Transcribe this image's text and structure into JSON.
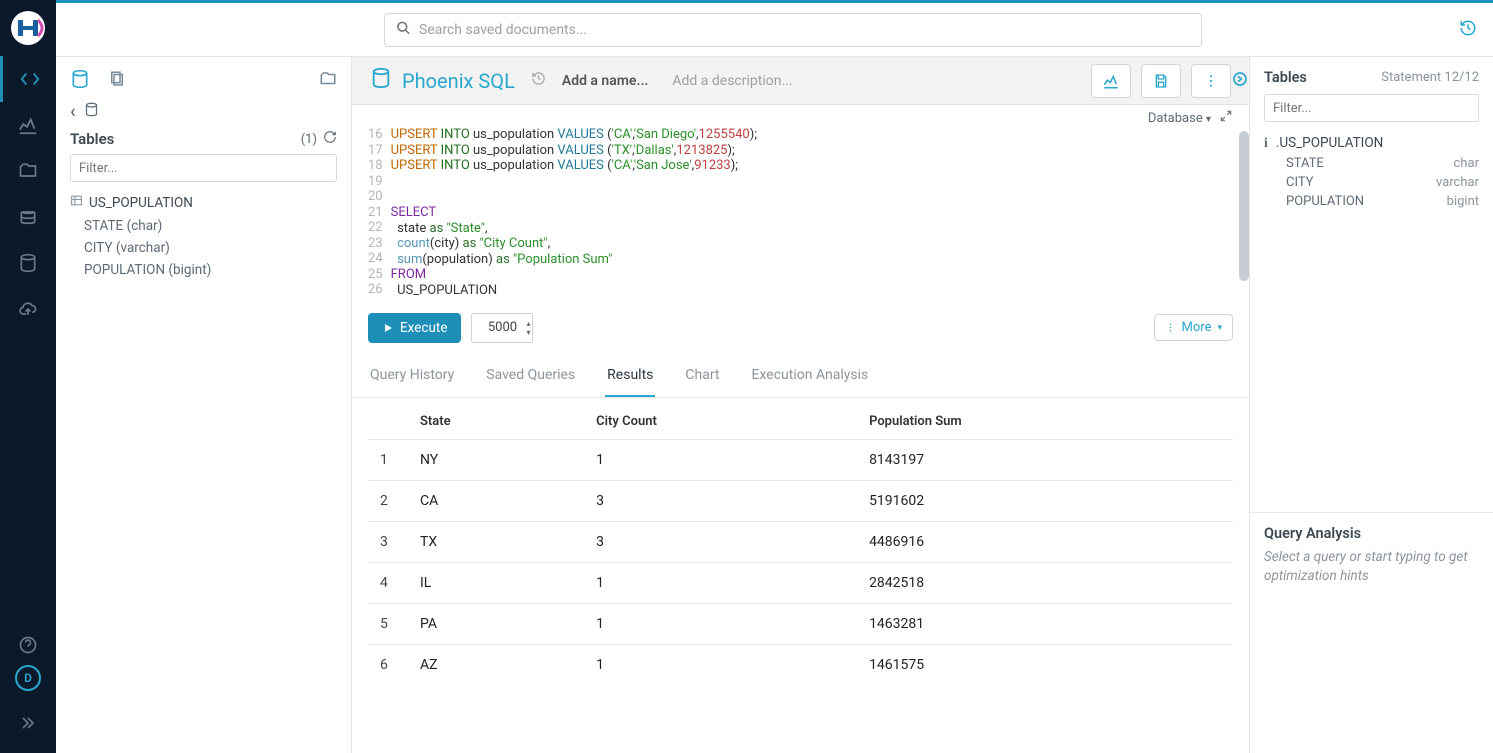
{
  "search": {
    "placeholder": "Search saved documents..."
  },
  "sidebar": {
    "title": "Tables",
    "count": "(1)",
    "filter_placeholder": "Filter...",
    "table_name": "US_POPULATION",
    "columns": [
      {
        "label": "STATE (char)"
      },
      {
        "label": "CITY (varchar)"
      },
      {
        "label": "POPULATION (bigint)"
      }
    ]
  },
  "editor": {
    "title": "Phoenix SQL",
    "add_name": "Add a name...",
    "add_desc": "Add a description...",
    "db_label": "Database",
    "execute": "Execute",
    "limit": "5000",
    "more": "More",
    "result_tabs": {
      "history": "Query History",
      "saved": "Saved Queries",
      "results": "Results",
      "chart": "Chart",
      "exec": "Execution Analysis"
    },
    "code_lines": [
      "16",
      "17",
      "18",
      "19",
      "20",
      "21",
      "22",
      "23",
      "24",
      "25",
      "26"
    ]
  },
  "results": {
    "headers": {
      "c1": "State",
      "c2": "City Count",
      "c3": "Population Sum"
    },
    "rows": [
      {
        "n": "1",
        "state": "NY",
        "cc": "1",
        "ps": "8143197"
      },
      {
        "n": "2",
        "state": "CA",
        "cc": "3",
        "ps": "5191602"
      },
      {
        "n": "3",
        "state": "TX",
        "cc": "3",
        "ps": "4486916"
      },
      {
        "n": "4",
        "state": "IL",
        "cc": "1",
        "ps": "2842518"
      },
      {
        "n": "5",
        "state": "PA",
        "cc": "1",
        "ps": "1463281"
      },
      {
        "n": "6",
        "state": "AZ",
        "cc": "1",
        "ps": "1461575"
      }
    ]
  },
  "assist": {
    "title": "Tables",
    "statement": "Statement 12/12",
    "filter_placeholder": "Filter...",
    "table_name": ".US_POPULATION",
    "cols": [
      {
        "name": "STATE",
        "type": "char"
      },
      {
        "name": "CITY",
        "type": "varchar"
      },
      {
        "name": "POPULATION",
        "type": "bigint"
      }
    ],
    "qa_title": "Query Analysis",
    "qa_hint": "Select a query or start typing to get optimization hints"
  },
  "user_initial": "D",
  "sql": {
    "l16_a": "UPSERT",
    "l16_b": "INTO",
    "l16_c": "us_population",
    "l16_d": "VALUES",
    "l16_e": "(",
    "l16_f": "'CA'",
    "l16_g": ",",
    "l16_h": "'San Diego'",
    "l16_i": ",",
    "l16_j": "1255540",
    "l16_k": ");",
    "l17_a": "UPSERT",
    "l17_b": "INTO",
    "l17_c": "us_population",
    "l17_d": "VALUES",
    "l17_e": "(",
    "l17_f": "'TX'",
    "l17_g": ",",
    "l17_h": "'Dallas'",
    "l17_i": ",",
    "l17_j": "1213825",
    "l17_k": ");",
    "l18_a": "UPSERT",
    "l18_b": "INTO",
    "l18_c": "us_population",
    "l18_d": "VALUES",
    "l18_e": "(",
    "l18_f": "'CA'",
    "l18_g": ",",
    "l18_h": "'San Jose'",
    "l18_i": ",",
    "l18_j": "91233",
    "l18_k": ");",
    "l21": "SELECT",
    "l22_a": "  state",
    "l22_b": "as",
    "l22_c": "\"State\"",
    "l22_d": ",",
    "l23_a": "count",
    "l23_b": "(city)",
    "l23_c": "as",
    "l23_d": "\"City Count\"",
    "l23_e": ",",
    "l24_a": "sum",
    "l24_b": "(population)",
    "l24_c": "as",
    "l24_d": "\"Population Sum\"",
    "l25": "FROM",
    "l26": "  US_POPULATION"
  }
}
